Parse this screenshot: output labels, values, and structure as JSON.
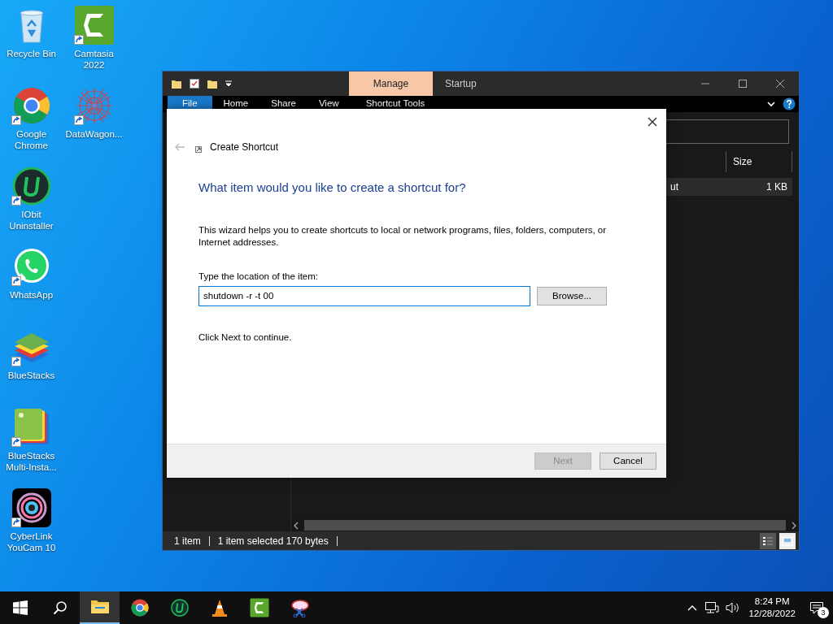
{
  "desktop_icons": [
    {
      "label": "Recycle Bin",
      "shortcut": false
    },
    {
      "label": "Google Chrome",
      "shortcut": true
    },
    {
      "label": "IObit Uninstaller",
      "shortcut": true
    },
    {
      "label": "WhatsApp",
      "shortcut": true
    },
    {
      "label": "BlueStacks",
      "shortcut": true
    },
    {
      "label": "BlueStacks Multi-Insta...",
      "shortcut": true
    },
    {
      "label": "CyberLink YouCam 10",
      "shortcut": true
    },
    {
      "label": "Camtasia 2022",
      "shortcut": true
    },
    {
      "label": "DataWagon...",
      "shortcut": true
    }
  ],
  "explorer": {
    "context_tab": "Manage",
    "title": "Startup",
    "ribbon_tabs": [
      {
        "label": "File",
        "kind": "file"
      },
      {
        "label": "Home",
        "kind": "tab"
      },
      {
        "label": "Share",
        "kind": "tab"
      },
      {
        "label": "View",
        "kind": "tab"
      },
      {
        "label": "Shortcut Tools",
        "kind": "context"
      }
    ],
    "columns": [
      "Size"
    ],
    "rows": [
      {
        "name": "ut",
        "size": "1 KB",
        "selected": true
      }
    ],
    "status_bar": [
      "1 item",
      "1 item selected  170 bytes"
    ],
    "view_buttons": [
      {
        "kind": "details",
        "selected": true
      },
      {
        "kind": "large-icons",
        "selected": false
      }
    ]
  },
  "dialog": {
    "title": "Create Shortcut",
    "heading": "What item would you like to create a shortcut for?",
    "description": "This wizard helps you to create shortcuts to local or network programs, files, folders, computers, or Internet addresses.",
    "field_label": "Type the location of the item:",
    "field_value": "shutdown -r -t 00",
    "browse_button": "Browse...",
    "hint": "Click Next to continue.",
    "buttons": [
      {
        "label": "Next",
        "disabled": true
      },
      {
        "label": "Cancel",
        "disabled": false
      }
    ]
  },
  "taskbar": {
    "apps": [
      {
        "active": true
      },
      {
        "active": false
      },
      {
        "active": false
      },
      {
        "active": false
      },
      {
        "active": false
      },
      {
        "active": false
      }
    ],
    "time": "8:24 PM",
    "date": "12/28/2022",
    "notification_count": "3"
  }
}
